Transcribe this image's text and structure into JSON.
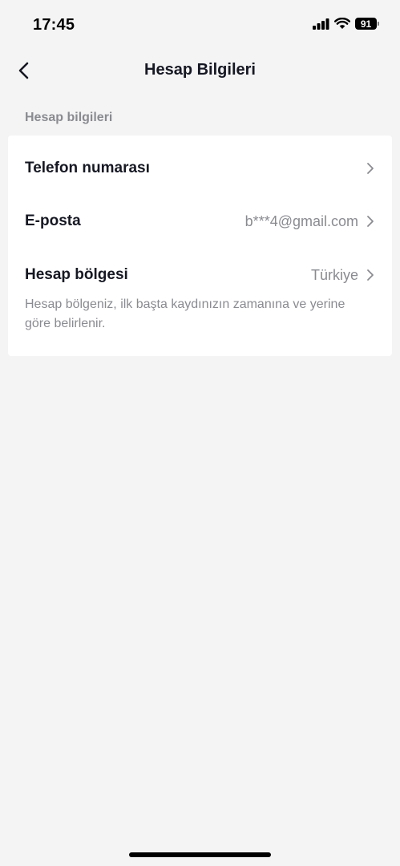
{
  "status_bar": {
    "time": "17:45",
    "battery": "91"
  },
  "header": {
    "title": "Hesap Bilgileri",
    "back_icon": "chevron-left-icon"
  },
  "section": {
    "label": "Hesap bilgileri"
  },
  "rows": [
    {
      "label": "Telefon numarası",
      "value": ""
    },
    {
      "label": "E-posta",
      "value": "b***4@gmail.com"
    },
    {
      "label": "Hesap bölgesi",
      "value": "Türkiye"
    }
  ],
  "region_hint": "Hesap bölgeniz, ilk başta kaydınızın zamanına ve yerine göre belirlenir."
}
